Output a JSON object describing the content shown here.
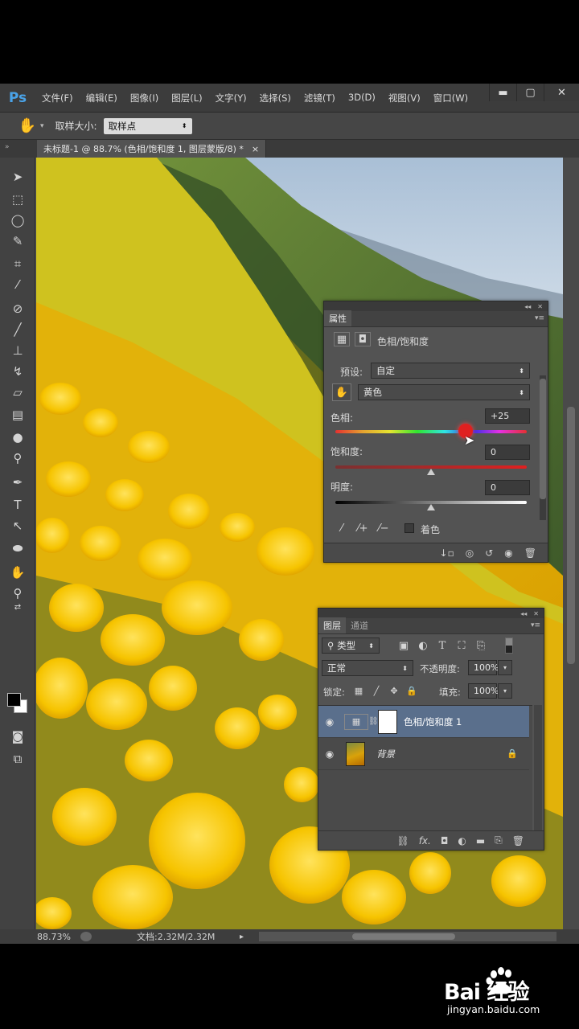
{
  "app": {
    "logo": "Ps",
    "menus": [
      "文件(F)",
      "编辑(E)",
      "图像(I)",
      "图层(L)",
      "文字(Y)",
      "选择(S)",
      "滤镜(T)",
      "3D(D)",
      "视图(V)",
      "窗口(W)"
    ],
    "window_controls": {
      "minimize": "▬",
      "restore": "▢",
      "close": "✕"
    }
  },
  "options_bar": {
    "sample_size_label": "取样大小:",
    "sample_size_value": "取样点"
  },
  "document_tab": {
    "title": "未标题-1 @ 88.7% (色相/饱和度 1, 图层蒙版/8) *",
    "close": "×"
  },
  "properties_panel": {
    "tab": "属性",
    "adjustment_title": "色相/饱和度",
    "preset_label": "预设:",
    "preset_value": "自定",
    "channel_value": "黄色",
    "hue_label": "色相:",
    "hue_value": "+25",
    "hue_level": 0.68,
    "saturation_label": "饱和度:",
    "saturation_value": "0",
    "lightness_label": "明度:",
    "lightness_value": "0",
    "colorize_label": "着色"
  },
  "layers_panel": {
    "tabs": [
      "图层",
      "通道"
    ],
    "filter_label": "类型",
    "blend_mode": "正常",
    "opacity_label": "不透明度:",
    "opacity_value": "100%",
    "lock_label": "锁定:",
    "fill_label": "填充:",
    "fill_value": "100%",
    "layers": [
      {
        "name": "色相/饱和度 1",
        "selected": true
      },
      {
        "name": "背景",
        "selected": false
      }
    ]
  },
  "status_bar": {
    "zoom": "88.73%",
    "doc_size": "文档:2.32M/2.32M"
  },
  "watermark": {
    "brand": "Bai 经验",
    "url": "jingyan.baidu.com"
  },
  "colors": {
    "accent_blue": "#4aa3e8",
    "selected_layer": "#5a6f8c",
    "flower_yellow": "#f4c20d"
  }
}
